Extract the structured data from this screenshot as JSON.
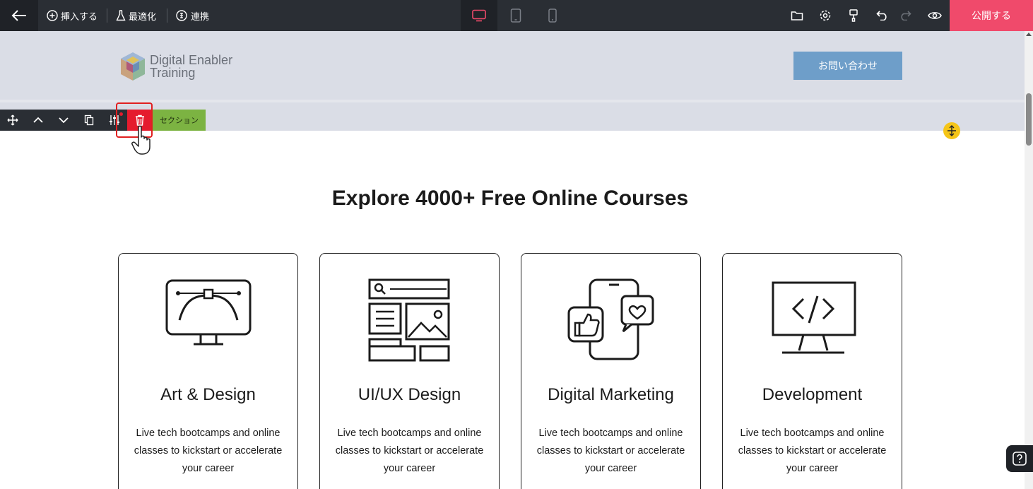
{
  "topbar": {
    "insert_label": "挿入する",
    "optimize_label": "最適化",
    "integrate_label": "連携",
    "publish_label": "公開する"
  },
  "header": {
    "logo_line1": "Digital Enabler",
    "logo_line2": "Training",
    "contact_label": "お問い合わせ"
  },
  "section_toolbar": {
    "label": "セクション"
  },
  "main": {
    "title": "Explore 4000+ Free Online Courses",
    "cards": [
      {
        "title": "Art & Design",
        "desc": "Live tech bootcamps and online classes to kickstart or accelerate your career"
      },
      {
        "title": "UI/UX Design",
        "desc": "Live tech bootcamps and online classes to kickstart or accelerate your career"
      },
      {
        "title": "Digital Marketing",
        "desc": "Live tech bootcamps and online classes to kickstart or accelerate your career"
      },
      {
        "title": "Development",
        "desc": "Live tech bootcamps and online classes to kickstart or accelerate your career"
      }
    ]
  },
  "colors": {
    "topbar_bg": "#2a2e34",
    "publish_bg": "#f04a6b",
    "header_bg": "#dadde6",
    "contact_bg": "#6e9ec9",
    "section_label_bg": "#7cb342",
    "delete_bg": "#e51b2e",
    "active_device": "#f04a6b"
  },
  "icons": [
    "back-arrow-icon",
    "plus-circle-icon",
    "flask-icon",
    "link-coin-icon",
    "desktop-icon",
    "tablet-icon",
    "mobile-icon",
    "folder-icon",
    "gear-icon",
    "brush-icon",
    "undo-icon",
    "redo-icon",
    "eye-icon",
    "move-icon",
    "chevron-up-icon",
    "chevron-down-icon",
    "duplicate-icon",
    "sliders-icon",
    "trash-icon",
    "resize-icon",
    "help-icon"
  ]
}
